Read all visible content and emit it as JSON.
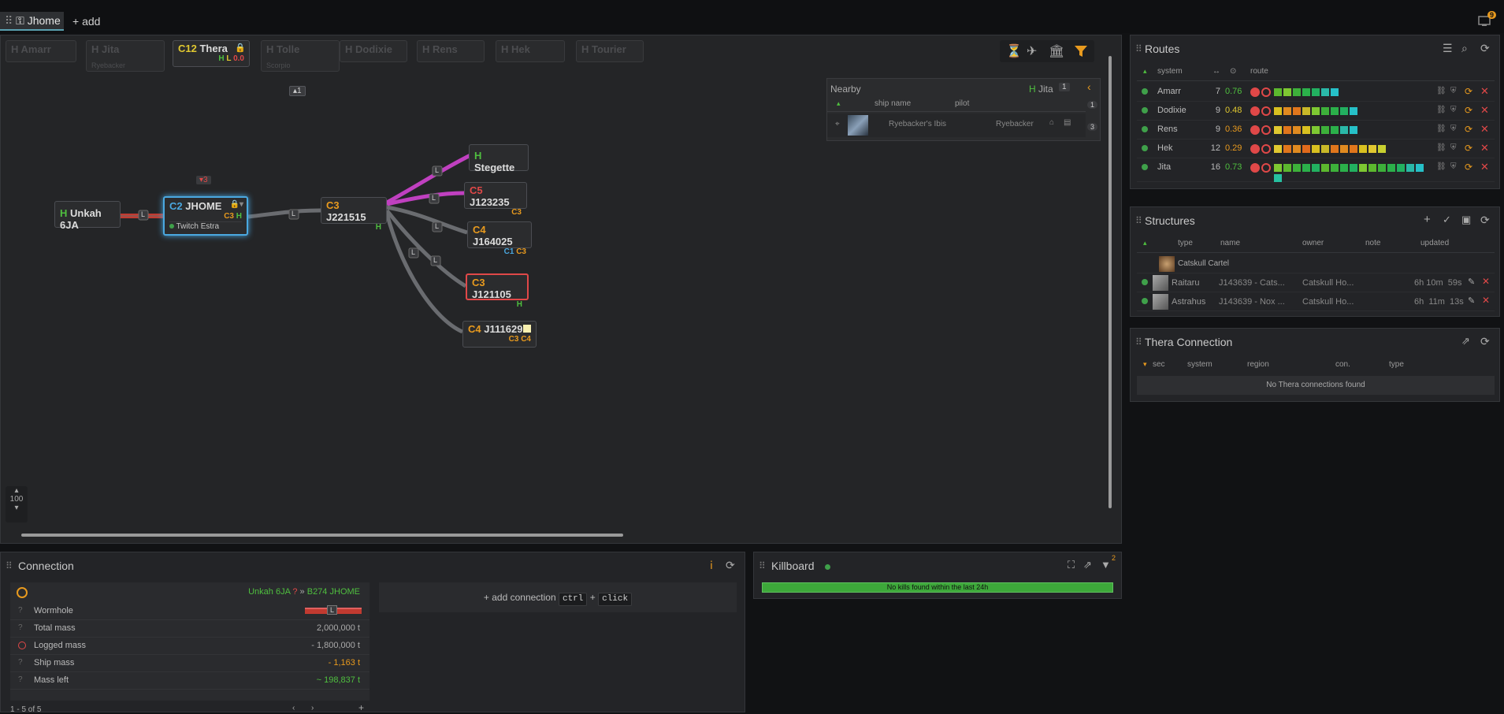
{
  "tabs": {
    "active": "Jhome",
    "add": "add",
    "notif_count": "9"
  },
  "map": {
    "ghost_systems": [
      {
        "label": "H Amarr"
      },
      {
        "label": "H Jita"
      },
      {
        "label": "H Tolle"
      },
      {
        "label": "H Dodixie"
      },
      {
        "label": "H Rens"
      },
      {
        "label": "H Hek"
      },
      {
        "label": "H Tourier"
      }
    ],
    "ghost_subs": {
      "jita": "Ryebacker",
      "tolle": "Scorpio"
    },
    "thera": {
      "cls": "C12",
      "name": "Thera",
      "h": "H",
      "l": "L",
      "sec": "0.0"
    },
    "tolle_badge": "1",
    "zoom": "100",
    "signature_badge": "3",
    "systems": {
      "unkah": {
        "sec": "H",
        "name": "Unkah 6JA"
      },
      "jhome": {
        "cls": "C2",
        "name": "JHOME",
        "s1": "C3",
        "s2": "H",
        "pilot": "Twitch Estra"
      },
      "j221515": {
        "cls": "C3",
        "name": "J221515",
        "s1": "H"
      },
      "stegette": {
        "sec": "H",
        "name": "Stegette"
      },
      "j123235": {
        "cls": "C5",
        "name": "J123235",
        "s1": "C3"
      },
      "j164025": {
        "cls": "C4",
        "name": "J164025",
        "s1": "C1",
        "s2": "C3"
      },
      "j121105": {
        "cls": "C3",
        "name": "J121105",
        "s1": "H"
      },
      "j111629": {
        "cls": "C4",
        "name": "J111629",
        "s1": "C3",
        "s2": "C4"
      }
    },
    "conn_label": "L"
  },
  "nearby": {
    "title": "Nearby",
    "sec": "H",
    "system": "Jita",
    "count": "1",
    "cols": [
      "ship name",
      "pilot"
    ],
    "ship": "Ryebacker's Ibis",
    "pilot": "Ryebacker",
    "side_counts": [
      "1",
      "3"
    ]
  },
  "routes": {
    "title": "Routes",
    "cols": [
      "system",
      "route"
    ],
    "rows": [
      {
        "system": "Amarr",
        "jumps": "7",
        "sec": "0.76",
        "secColor": "#4fbf3f",
        "sq": [
          "#5cb82e",
          "#7ec832",
          "#3db03a",
          "#2bb04a",
          "#22b060",
          "#2ab8a8",
          "#26c0c8"
        ]
      },
      {
        "system": "Dodixie",
        "jumps": "9",
        "sec": "0.48",
        "secColor": "#e0c830",
        "sq": [
          "#d8c020",
          "#e08a20",
          "#e0761c",
          "#c8b828",
          "#7ec832",
          "#3db03a",
          "#2bb04a",
          "#22b060",
          "#26c0c8"
        ]
      },
      {
        "system": "Rens",
        "jumps": "9",
        "sec": "0.36",
        "secColor": "#e89a1e",
        "sq": [
          "#e0c830",
          "#e0761c",
          "#e08a20",
          "#d8c020",
          "#7ec832",
          "#3db03a",
          "#2bb04a",
          "#2ab8a8",
          "#26c0c8"
        ]
      },
      {
        "system": "Hek",
        "jumps": "12",
        "sec": "0.29",
        "secColor": "#e89a1e",
        "sq": [
          "#e0c830",
          "#e0761c",
          "#e08a20",
          "#e06a1c",
          "#d8c020",
          "#c8b828",
          "#e0761c",
          "#e08a20",
          "#e0761c",
          "#d8c020",
          "#e0c830",
          "#c8d030"
        ]
      },
      {
        "system": "Jita",
        "jumps": "16",
        "sec": "0.73",
        "secColor": "#4fbf3f",
        "sq": [
          "#7ec832",
          "#5cb82e",
          "#3db03a",
          "#2bb04a",
          "#22b060",
          "#5cb82e",
          "#3db03a",
          "#2bb04a",
          "#22b060",
          "#7ec832",
          "#5cb82e",
          "#3db03a",
          "#2bb04a",
          "#22b060",
          "#2ab8a8",
          "#26c0c8",
          "#26c0a0"
        ]
      }
    ]
  },
  "structures": {
    "title": "Structures",
    "cols": [
      "type",
      "name",
      "owner",
      "note",
      "updated"
    ],
    "group": "Catskull Cartel",
    "rows": [
      {
        "type": "Raitaru",
        "name": "J143639 - Cats...",
        "owner": "Catskull Ho...",
        "updated": "6h 10m  59s"
      },
      {
        "type": "Astrahus",
        "name": "J143639 - Nox ...",
        "owner": "Catskull Ho...",
        "updated": "6h  11m  13s"
      }
    ]
  },
  "thera_conn": {
    "title": "Thera Connection",
    "cols": [
      "sec",
      "system",
      "region",
      "con.",
      "type"
    ],
    "empty": "No Thera connections found"
  },
  "connection": {
    "title": "Connection",
    "from": "Unkah 6JA",
    "wh": "B274",
    "to": "JHOME",
    "label": "L",
    "rows": [
      {
        "label": "Wormhole",
        "value": ""
      },
      {
        "label": "Total mass",
        "value": "2,000,000 t"
      },
      {
        "label": "Logged mass",
        "value": "- 1,800,000 t"
      },
      {
        "label": "Ship mass",
        "value": "- 1,163 t"
      },
      {
        "label": "Mass left",
        "value": "~ 198,837 t"
      }
    ],
    "pager": "1 - 5 of 5",
    "add": "add connection",
    "ctrl": "ctrl",
    "plus": "+",
    "click": "click"
  },
  "killboard": {
    "title": "Killboard",
    "filter_count": "2",
    "empty": "No kills found within the last 24h"
  },
  "colors": {
    "accent": "#e89a1e",
    "green": "#4fbf3f",
    "red": "#e04848",
    "highsec": "#4fbf3f"
  }
}
